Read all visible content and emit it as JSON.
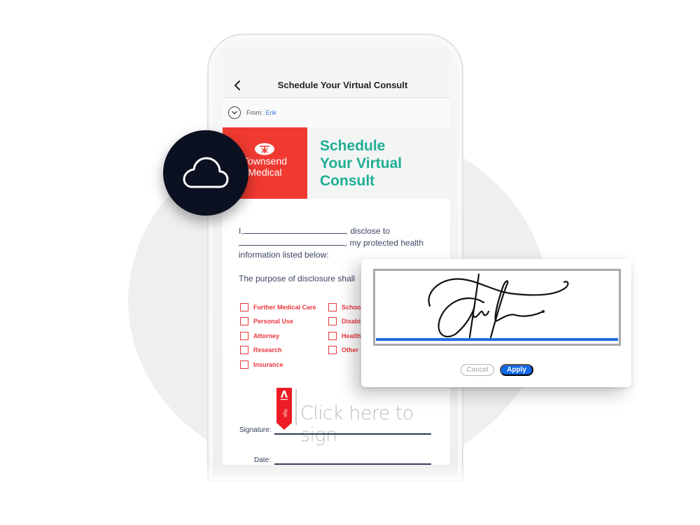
{
  "app": {
    "nav_title": "Schedule Your Virtual Consult",
    "back_icon": "chevron-left-icon"
  },
  "sender": {
    "from_label": "From:",
    "from_name": "Erik",
    "expand_icon": "chevron-down-circle-icon"
  },
  "banner": {
    "logo_line1": "Townsend",
    "logo_line2": "Medical",
    "title_line1": "Schedule",
    "title_line2": "Your Virtual",
    "title_line3": "Consult",
    "logo_color": "#f03a31",
    "title_color": "#1fae93"
  },
  "document": {
    "line1_prefix": "I,",
    "line1_suffix": ", disclose to",
    "line2_suffix": ", my protected health",
    "line3": "information listed below:",
    "purpose": "The purpose of disclosure shall"
  },
  "checkboxes": {
    "left": [
      {
        "label": "Further Medical Care",
        "checked": false
      },
      {
        "label": "Personal Use",
        "checked": false
      },
      {
        "label": "Attorney",
        "checked": false
      },
      {
        "label": "Research",
        "checked": false
      },
      {
        "label": "Insurance",
        "checked": false
      }
    ],
    "right": [
      {
        "label": "School",
        "checked": false
      },
      {
        "label": "Disabi",
        "checked": false
      },
      {
        "label": "Health",
        "checked": false
      },
      {
        "label": "Other",
        "checked": false
      }
    ],
    "color": "#e8383d"
  },
  "signing": {
    "flag_brand": "Adobe",
    "flag_label": "Sign",
    "placeholder": "Click here to sign",
    "signature_label": "Signature:",
    "date_label": "Date:"
  },
  "cloud_badge": {
    "icon": "cloud-icon"
  },
  "signature_dialog": {
    "cancel_label": "Cancel",
    "apply_label": "Apply",
    "accent_color": "#1268e8"
  }
}
